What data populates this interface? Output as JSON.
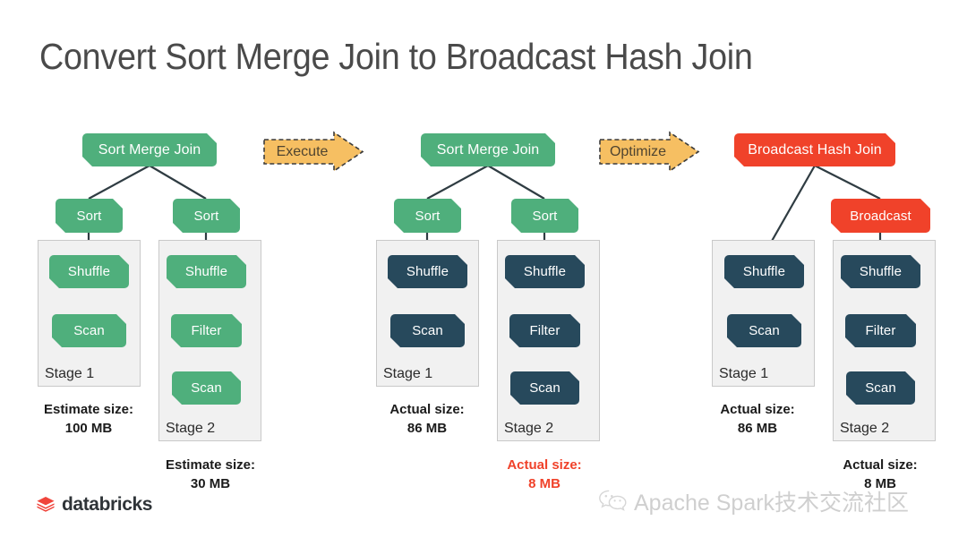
{
  "slide": {
    "title": "Convert Sort Merge Join to Broadcast Hash Join",
    "background": "#ffffff"
  },
  "colors": {
    "green": "#4faf7c",
    "navy": "#27495c",
    "red": "#f0422a",
    "arrow_fill": "#f6bf62",
    "arrow_border": "#3c3c3c",
    "stage_fill": "#f1f1f1",
    "stage_border": "#c9c9c9",
    "title_text": "#4a4a4a"
  },
  "arrows": [
    {
      "label": "Execute"
    },
    {
      "label": "Optimize"
    }
  ],
  "panels": [
    {
      "id": "panel-logical-plan",
      "root": {
        "label": "Sort Merge Join",
        "color": "green"
      },
      "nodes": [
        {
          "label": "Sort",
          "color": "green"
        },
        {
          "label": "Sort",
          "color": "green"
        },
        {
          "label": "Shuffle",
          "color": "green"
        },
        {
          "label": "Scan",
          "color": "green"
        },
        {
          "label": "Shuffle",
          "color": "green"
        },
        {
          "label": "Filter",
          "color": "green"
        },
        {
          "label": "Scan",
          "color": "green"
        }
      ],
      "stages": [
        {
          "label": "Stage 1"
        },
        {
          "label": "Stage 2"
        }
      ],
      "size_labels": [
        {
          "title": "Estimate size:",
          "value": "100 MB",
          "emphasis": "normal"
        },
        {
          "title": "Estimate size:",
          "value": "30 MB",
          "emphasis": "normal"
        }
      ]
    },
    {
      "id": "panel-executed-plan",
      "root": {
        "label": "Sort Merge Join",
        "color": "green"
      },
      "nodes": [
        {
          "label": "Sort",
          "color": "green"
        },
        {
          "label": "Sort",
          "color": "green"
        },
        {
          "label": "Shuffle",
          "color": "navy"
        },
        {
          "label": "Scan",
          "color": "navy"
        },
        {
          "label": "Shuffle",
          "color": "navy"
        },
        {
          "label": "Filter",
          "color": "navy"
        },
        {
          "label": "Scan",
          "color": "navy"
        }
      ],
      "stages": [
        {
          "label": "Stage 1"
        },
        {
          "label": "Stage 2"
        }
      ],
      "size_labels": [
        {
          "title": "Actual size:",
          "value": "86 MB",
          "emphasis": "normal"
        },
        {
          "title": "Actual size:",
          "value": "8 MB",
          "emphasis": "red"
        }
      ]
    },
    {
      "id": "panel-optimized-plan",
      "root": {
        "label": "Broadcast Hash Join",
        "color": "red"
      },
      "nodes": [
        {
          "label": "Broadcast",
          "color": "red"
        },
        {
          "label": "Shuffle",
          "color": "navy"
        },
        {
          "label": "Scan",
          "color": "navy"
        },
        {
          "label": "Shuffle",
          "color": "navy"
        },
        {
          "label": "Filter",
          "color": "navy"
        },
        {
          "label": "Scan",
          "color": "navy"
        }
      ],
      "stages": [
        {
          "label": "Stage 1"
        },
        {
          "label": "Stage 2"
        }
      ],
      "size_labels": [
        {
          "title": "Actual size:",
          "value": "86 MB",
          "emphasis": "normal"
        },
        {
          "title": "Actual size:",
          "value": "8 MB",
          "emphasis": "normal"
        }
      ]
    }
  ],
  "logo": {
    "name": "databricks",
    "icon": "databricks-stack-icon"
  },
  "watermark": {
    "icon": "wechat-icon",
    "text": "Apache Spark技术交流社区"
  }
}
